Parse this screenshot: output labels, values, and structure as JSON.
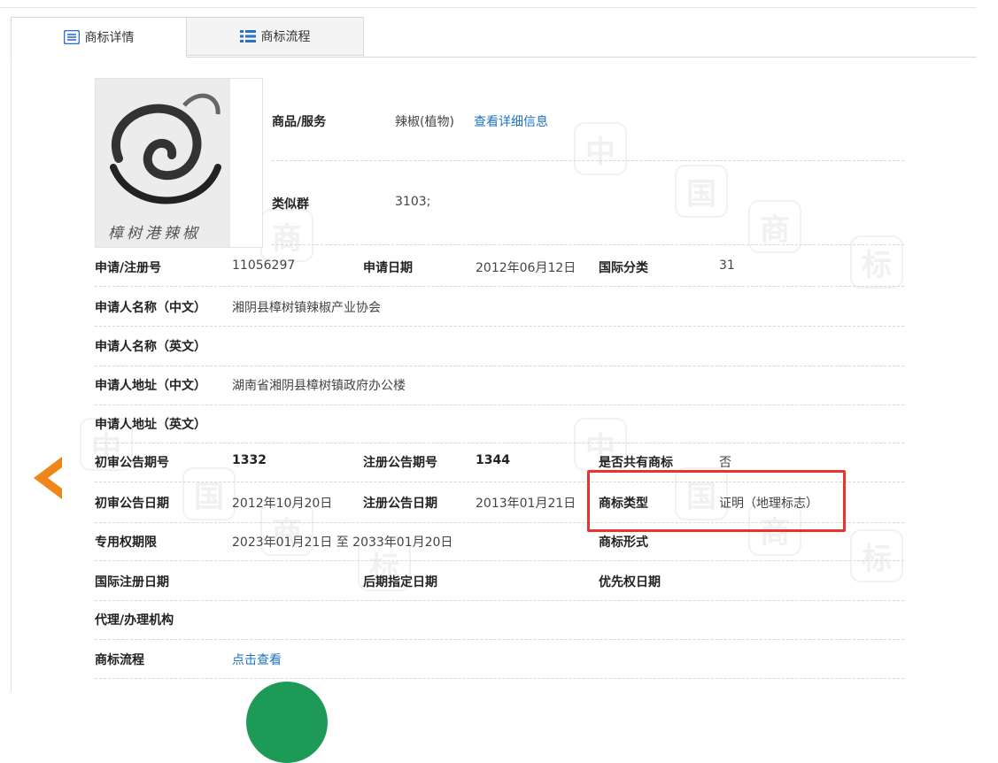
{
  "tabs": [
    {
      "label": "商标详情",
      "icon": "list-icon",
      "active": true
    },
    {
      "label": "商标流程",
      "icon": "flow-icon",
      "active": false
    }
  ],
  "trademark_image": {
    "text": "樟树港辣椒"
  },
  "goods": {
    "label": "商品/服务",
    "value": "辣椒(植物)",
    "link": "查看详细信息"
  },
  "similar_group": {
    "label": "类似群",
    "value": "3103;"
  },
  "details": {
    "reg_no_label": "申请/注册号",
    "reg_no": "11056297",
    "app_date_label": "申请日期",
    "app_date": "2012年06月12日",
    "intl_class_label": "国际分类",
    "intl_class": "31",
    "applicant_cn_label": "申请人名称（中文）",
    "applicant_cn": "湘阴县樟树镇辣椒产业协会",
    "applicant_en_label": "申请人名称（英文）",
    "applicant_en": "",
    "address_cn_label": "申请人地址（中文）",
    "address_cn": "湖南省湘阴县樟树镇政府办公楼",
    "address_en_label": "申请人地址（英文）",
    "address_en": "",
    "prelim_no_label": "初审公告期号",
    "prelim_no": "1332",
    "reg_pub_no_label": "注册公告期号",
    "reg_pub_no": "1344",
    "shared_label": "是否共有商标",
    "shared": "否",
    "prelim_date_label": "初审公告日期",
    "prelim_date": "2012年10月20日",
    "reg_pub_date_label": "注册公告日期",
    "reg_pub_date": "2013年01月21日",
    "tm_type_label": "商标类型",
    "tm_type": "证明（地理标志）",
    "exclusive_label": "专用权期限",
    "exclusive": "2023年01月21日 至 2033年01月20日",
    "tm_form_label": "商标形式",
    "tm_form": "",
    "intl_reg_date_label": "国际注册日期",
    "later_date_label": "后期指定日期",
    "priority_date_label": "优先权日期",
    "agent_label": "代理/办理机构",
    "process_label": "商标流程",
    "process_link": "点击查看"
  },
  "watermark_chars": [
    "中",
    "国",
    "商",
    "标"
  ],
  "colors": {
    "accent_link": "#1a73c7",
    "arrow": "#f08519",
    "highlight_box": "#e8332f",
    "tab_icon": "#2a6fc9"
  }
}
